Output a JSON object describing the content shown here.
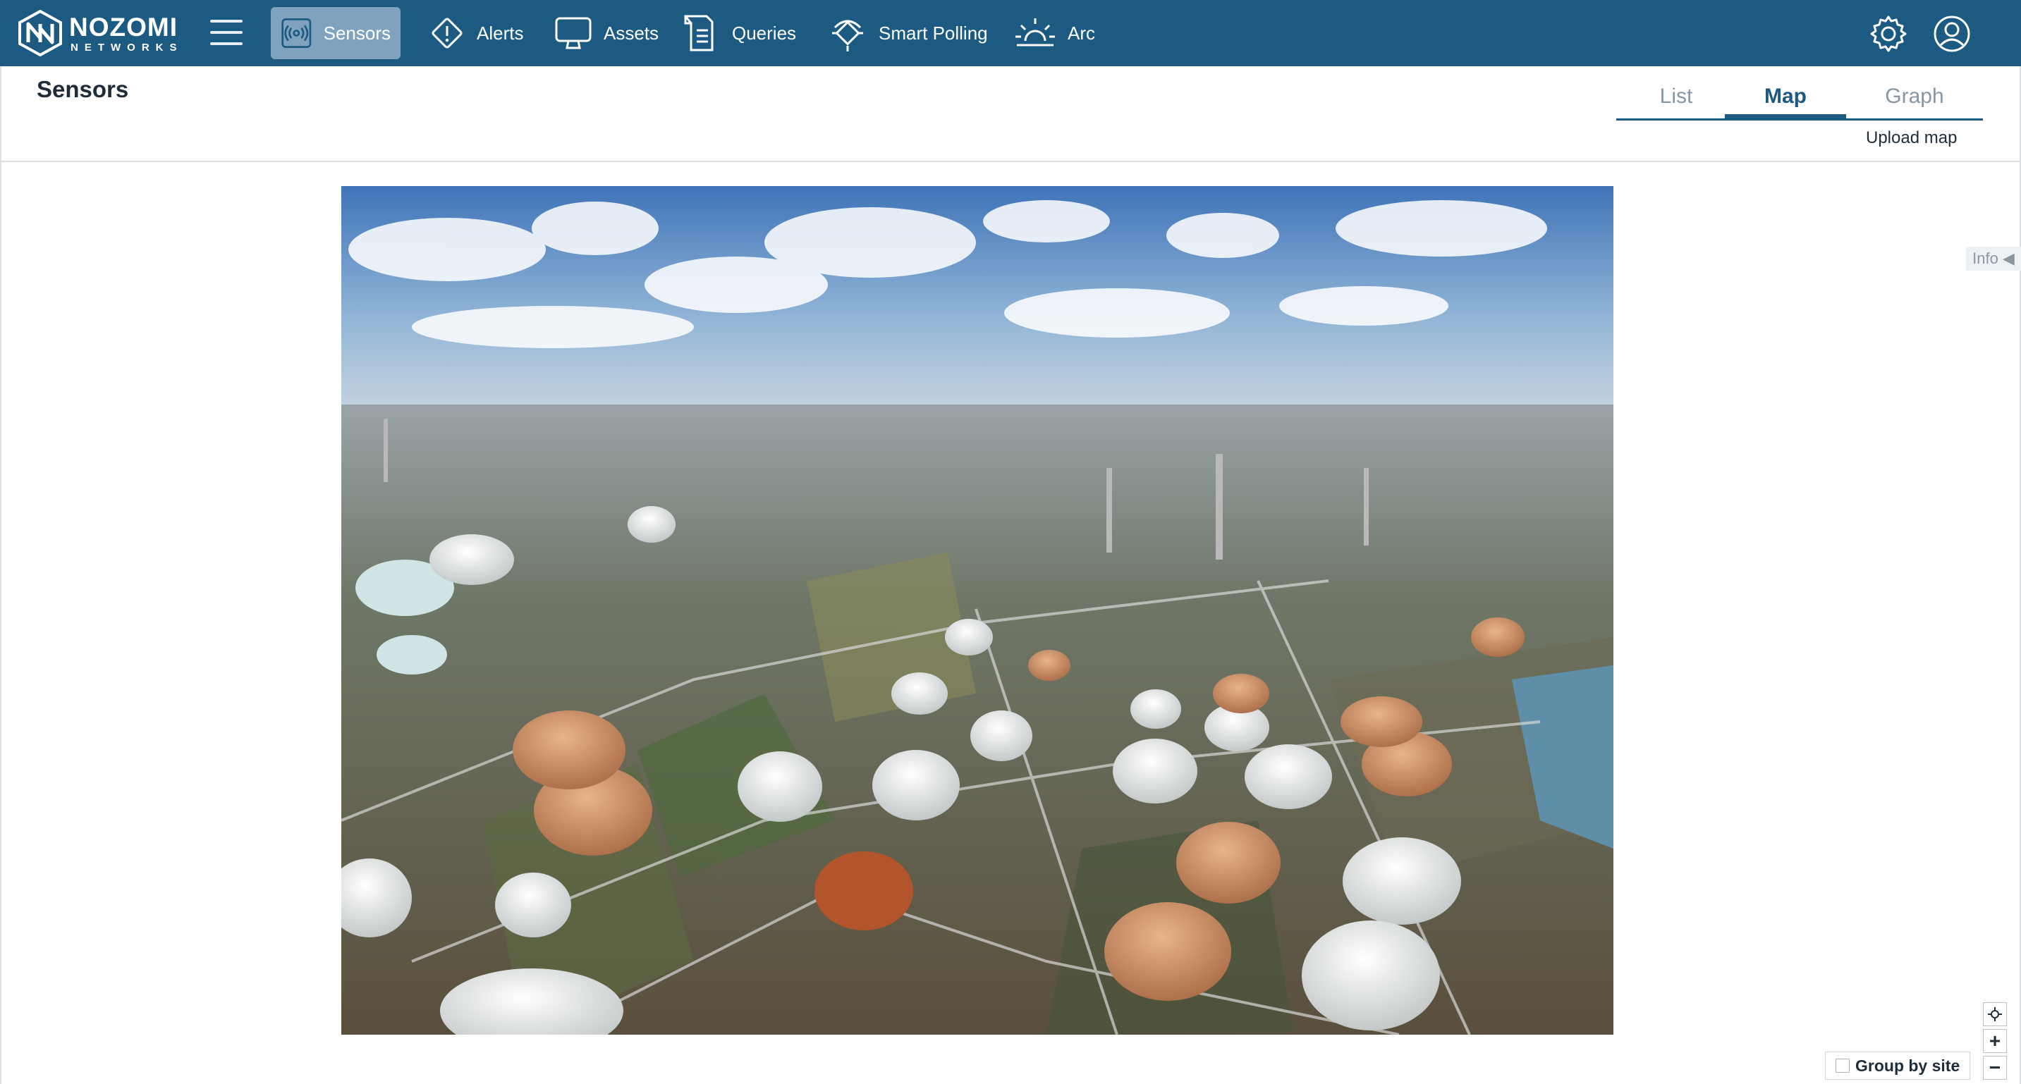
{
  "brand": {
    "name": "NOZOMI",
    "subtitle": "NETWORKS"
  },
  "nav": {
    "items": [
      {
        "label": "Sensors",
        "icon": "sensor-icon",
        "active": true
      },
      {
        "label": "Alerts",
        "icon": "alert-icon"
      },
      {
        "label": "Assets",
        "icon": "monitor-icon"
      },
      {
        "label": "Queries",
        "icon": "query-list-icon"
      },
      {
        "label": "Smart Polling",
        "icon": "smart-polling-icon"
      },
      {
        "label": "Arc",
        "icon": "arc-sun-icon"
      }
    ],
    "right_icons": [
      "gear-icon",
      "user-icon"
    ]
  },
  "page": {
    "title": "Sensors",
    "tabs": [
      {
        "label": "List"
      },
      {
        "label": "Map",
        "active": true
      },
      {
        "label": "Graph"
      }
    ],
    "upload_label": "Upload map"
  },
  "map": {
    "image_subject": "aerial photo of industrial oil refinery tank farm",
    "info_label": "Info ◀",
    "zoom_controls": [
      "locate-icon",
      "+",
      "−"
    ],
    "group_by_site_label": "Group by site",
    "group_by_site_checked": false
  },
  "colors": {
    "nav_bg": "#1d5a82",
    "nav_active": "#7fa3be",
    "accent": "#1d5a82"
  }
}
